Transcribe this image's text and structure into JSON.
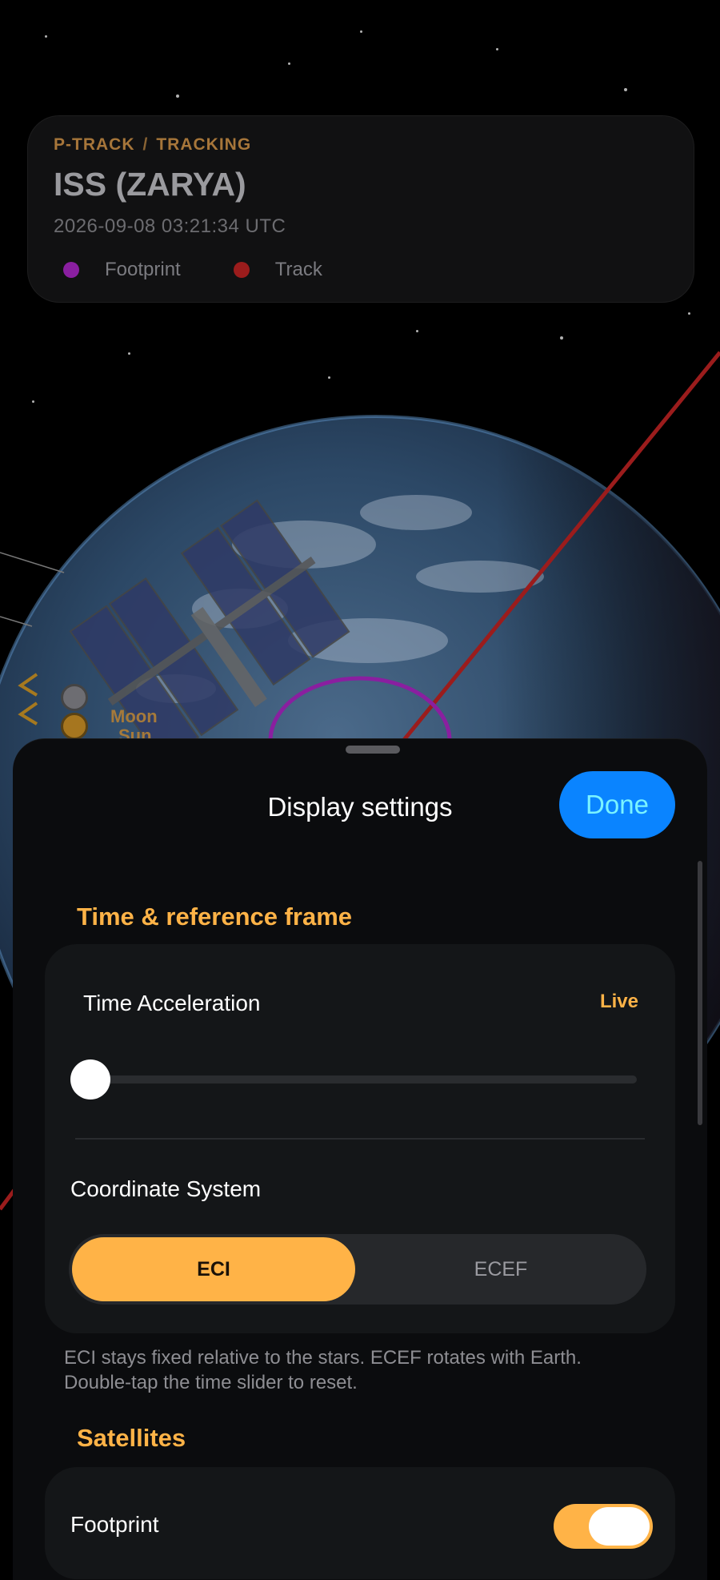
{
  "header": {
    "crumb_app": "P-TRACK",
    "crumb_separator": "/",
    "crumb_section": "TRACKING",
    "satellite_name": "ISS (ZARYA)",
    "timestamp": "2026-09-08 03:21:34 UTC",
    "legend": [
      {
        "label": "Footprint",
        "color": "#8a1fa0"
      },
      {
        "label": "Track",
        "color": "#9b1c1c"
      }
    ]
  },
  "globe": {
    "moon_label": "Moon",
    "sun_label": "Sun"
  },
  "sheet": {
    "title": "Display settings",
    "done_label": "Done",
    "sections": {
      "time": {
        "header": "Time & reference frame",
        "time_acceleration_label": "Time Acceleration",
        "time_acceleration_value": "Live",
        "slider_position": 0,
        "coordinate_label": "Coordinate System",
        "options": [
          "ECI",
          "ECEF"
        ],
        "selected": "ECI",
        "hint": "ECI stays fixed relative to the stars. ECEF rotates with Earth. Double-tap the time slider to reset."
      },
      "satellites": {
        "header": "Satellites",
        "footprint_label": "Footprint",
        "footprint_enabled": true
      }
    }
  },
  "colors": {
    "accent": "#ffb347",
    "done_button": "#0a84ff",
    "track": "#9b1c1c",
    "footprint": "#8a1fa0"
  }
}
